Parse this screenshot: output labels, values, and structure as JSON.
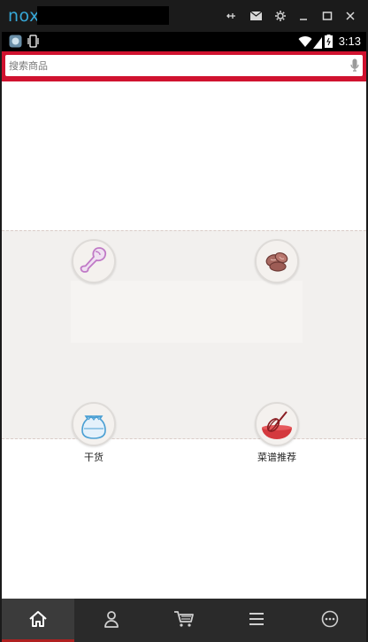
{
  "emulator": {
    "logo": "nox",
    "controls": [
      "pin-icon",
      "mail-icon",
      "settings-icon",
      "minimize-icon",
      "maximize-icon",
      "close-icon"
    ]
  },
  "status_bar": {
    "time": "3:13"
  },
  "search": {
    "placeholder": "搜索商品"
  },
  "categories": [
    {
      "label": "",
      "icon": "drumstick-icon"
    },
    {
      "label": "",
      "icon": "meat-icon"
    },
    {
      "label": "干货",
      "icon": "dry-goods-sack-icon"
    },
    {
      "label": "菜谱推荐",
      "icon": "recipe-whisk-bowl-icon"
    }
  ],
  "bottom_nav": {
    "items": [
      "home-icon",
      "user-icon",
      "cart-icon",
      "menu-icon",
      "more-icon"
    ],
    "active": "home-icon"
  },
  "colors": {
    "accent": "#d0122f",
    "nav_bg": "#2a2a2a",
    "category_bg": "#f2f0ee"
  }
}
